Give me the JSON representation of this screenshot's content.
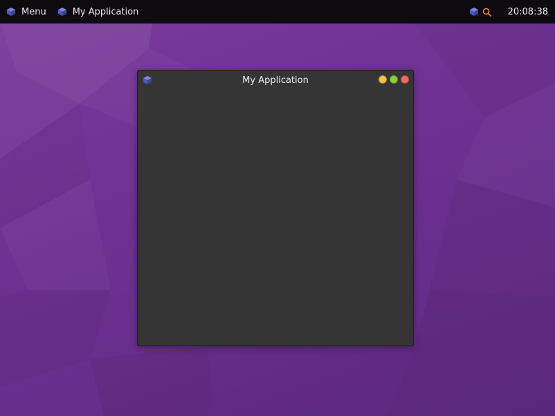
{
  "taskbar": {
    "menu_label": "Menu",
    "menu_icon": "cube-icon",
    "active_app_label": "My Application",
    "active_app_icon": "cube-icon",
    "tray_icons": [
      "cube-icon",
      "search-icon"
    ],
    "clock": "20:08:38"
  },
  "window": {
    "title": "My Application",
    "icon": "cube-icon",
    "controls": [
      "minimize",
      "maximize",
      "close"
    ]
  },
  "colors": {
    "desktop": "#6e3191",
    "taskbar": "#0f0a10",
    "window_bg": "#353535",
    "icon_blue": "#5060c8",
    "search_accent": "#f08a24",
    "minimize": "#f4c542",
    "maximize": "#84d13c",
    "close": "#ef6b5b"
  }
}
